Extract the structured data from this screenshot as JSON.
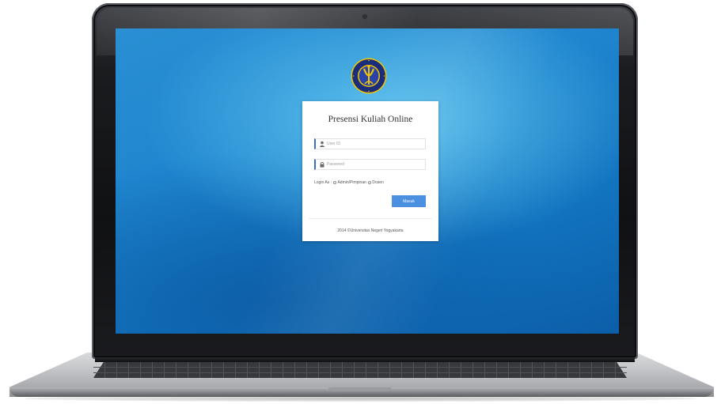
{
  "login": {
    "title": "Presensi Kuliah Online",
    "user_id_placeholder": "User ID",
    "password_placeholder": "Password",
    "login_as_label": "Login As :",
    "role_options": [
      "Admin/Pimpinan",
      "Dosen"
    ],
    "submit_label": "Masuk",
    "footer": "2014 ©Universitas Negeri Yogyakarta"
  },
  "colors": {
    "screen_blue": "#1f86cf",
    "button_blue": "#4a8fe0",
    "logo_navy": "#1a2c7a",
    "logo_gold": "#f2c500"
  },
  "icons": {
    "user_field": "user-icon",
    "password_field": "lock-icon",
    "logo": "university-crest-icon"
  }
}
